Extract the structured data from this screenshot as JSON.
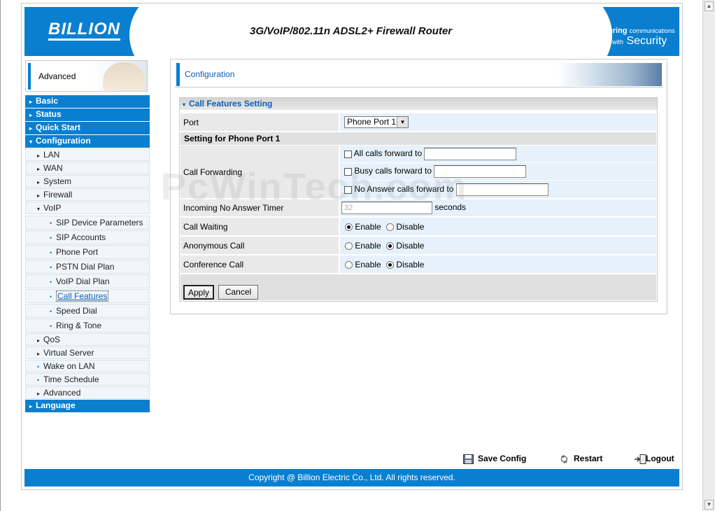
{
  "banner": {
    "logo": "BILLION",
    "title": "3G/VoIP/802.11n ADSL2+ Firewall Router",
    "tagline_top": "Powering",
    "tagline_top_small": "communications",
    "tagline_bottom_small": "with",
    "tagline_bottom": "Security"
  },
  "sidebar": {
    "mode_label": "Advanced",
    "items": [
      {
        "label": "Basic"
      },
      {
        "label": "Status"
      },
      {
        "label": "Quick Start"
      },
      {
        "label": "Configuration"
      },
      {
        "label": "LAN"
      },
      {
        "label": "WAN"
      },
      {
        "label": "System"
      },
      {
        "label": "Firewall"
      },
      {
        "label": "VoIP"
      },
      {
        "label": "SIP Device Parameters"
      },
      {
        "label": "SIP Accounts"
      },
      {
        "label": "Phone Port"
      },
      {
        "label": "PSTN Dial Plan"
      },
      {
        "label": "VoIP Dial Plan"
      },
      {
        "label": "Call Features"
      },
      {
        "label": "Speed Dial"
      },
      {
        "label": "Ring & Tone"
      },
      {
        "label": "QoS"
      },
      {
        "label": "Virtual Server"
      },
      {
        "label": "Wake on LAN"
      },
      {
        "label": "Time Schedule"
      },
      {
        "label": "Advanced"
      },
      {
        "label": "Language"
      }
    ]
  },
  "main": {
    "page_title": "Configuration",
    "section_title": "Call Features Setting",
    "port_label": "Port",
    "port_value": "Phone Port 1",
    "subheading": "Setting for Phone Port 1",
    "call_forwarding_label": "Call Forwarding",
    "all_calls_label": "All calls forward to",
    "busy_calls_label": "Busy calls forward to",
    "no_answer_label": "No Answer calls forward to",
    "timer_label": "Incoming No Answer Timer",
    "timer_value": "32",
    "timer_unit": "seconds",
    "call_waiting_label": "Call Waiting",
    "anonymous_label": "Anonymous Call",
    "conference_label": "Conference Call",
    "enable": "Enable",
    "disable": "Disable",
    "apply": "Apply",
    "cancel": "Cancel"
  },
  "footer": {
    "save": "Save Config",
    "restart": "Restart",
    "logout": "Logout",
    "copyright": "Copyright @ Billion Electric Co., Ltd. All rights reserved."
  },
  "watermark": "PcWinTech.com"
}
